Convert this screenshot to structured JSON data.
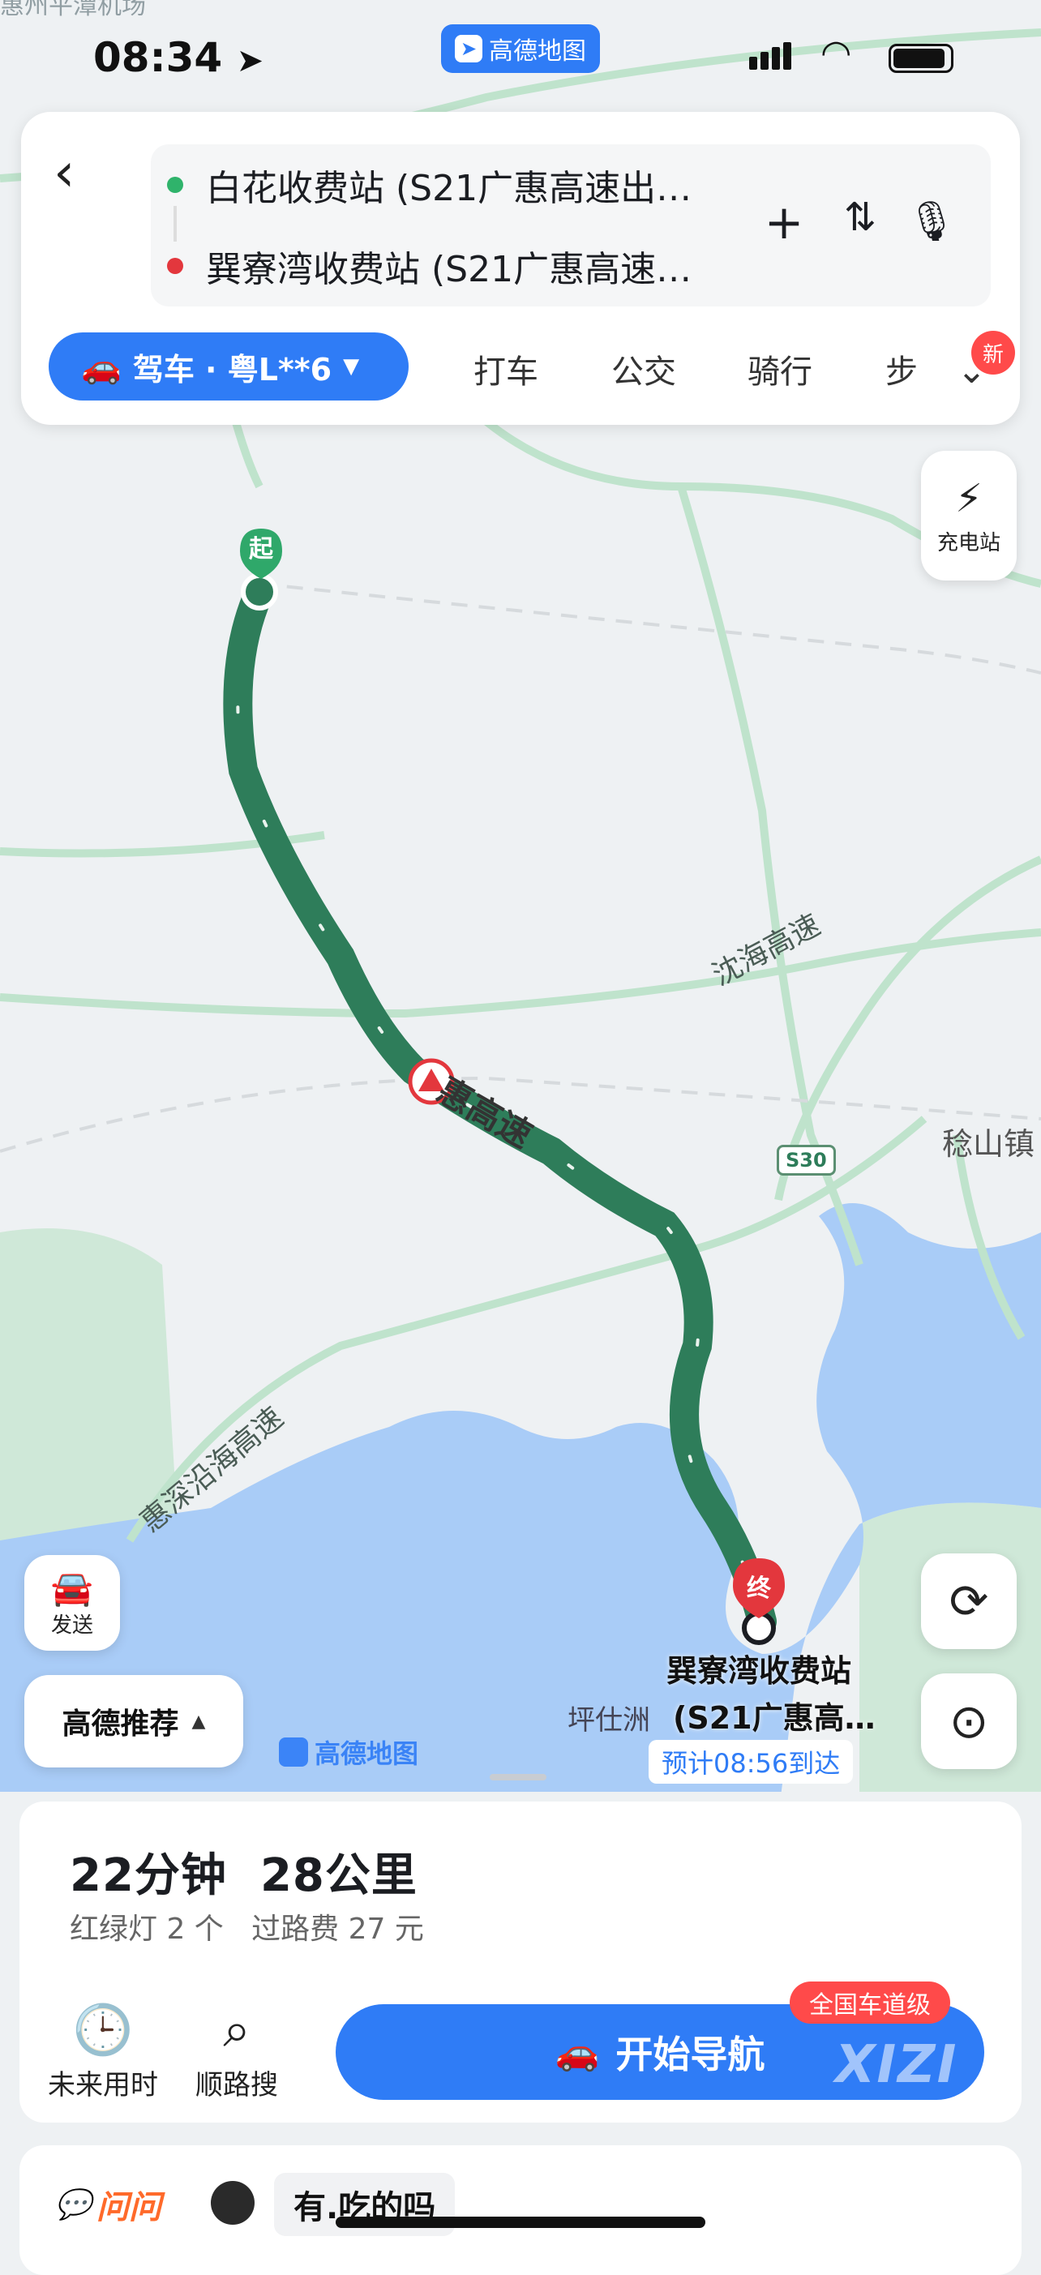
{
  "status_bar": {
    "time": "08:34",
    "app_badge": "高德地图",
    "top_ghost_text": "惠州平潭机场"
  },
  "route": {
    "origin": "白花收费站 (S21广惠高速出…",
    "destination": "巽寮湾收费站 (S21广惠高速…",
    "origin_color": "#2fb36b",
    "destination_color": "#e3373d"
  },
  "modes": {
    "active": "驾车 · 粤L**6",
    "items": [
      "打车",
      "公交",
      "骑行",
      "步"
    ],
    "new_badge": "新"
  },
  "map": {
    "charging_label": "充电站",
    "start_marker": "起",
    "end_marker": "终",
    "road_labels": {
      "huihai": "惠高速",
      "shenhai": "沈海高速",
      "huishen": "惠深沿海高速",
      "s30": "S30",
      "town": "稔山镇",
      "pingshizhou": "坪仕洲"
    },
    "destination_name": "巽寮湾收费站",
    "destination_sub": "(S21广惠高…",
    "eta_bubble": "预计08:56到达",
    "send_label": "发送",
    "recommend_label": "高德推荐",
    "watermark": "高德地图",
    "route_color": "#2e7d5a",
    "water_color": "#a9ccf7",
    "land_color": "#eef1f3"
  },
  "summary": {
    "duration": "22分钟",
    "distance": "28公里",
    "lights": "红绿灯 2 个",
    "toll": "过路费 27 元"
  },
  "tools": {
    "future": "未来用时",
    "search": "顺路搜"
  },
  "navigation": {
    "start_label": "开始导航",
    "badge": "全国车道级",
    "watermark": "XIZI"
  },
  "ask": {
    "brand": "问问",
    "prompt": "有.吃的吗"
  }
}
